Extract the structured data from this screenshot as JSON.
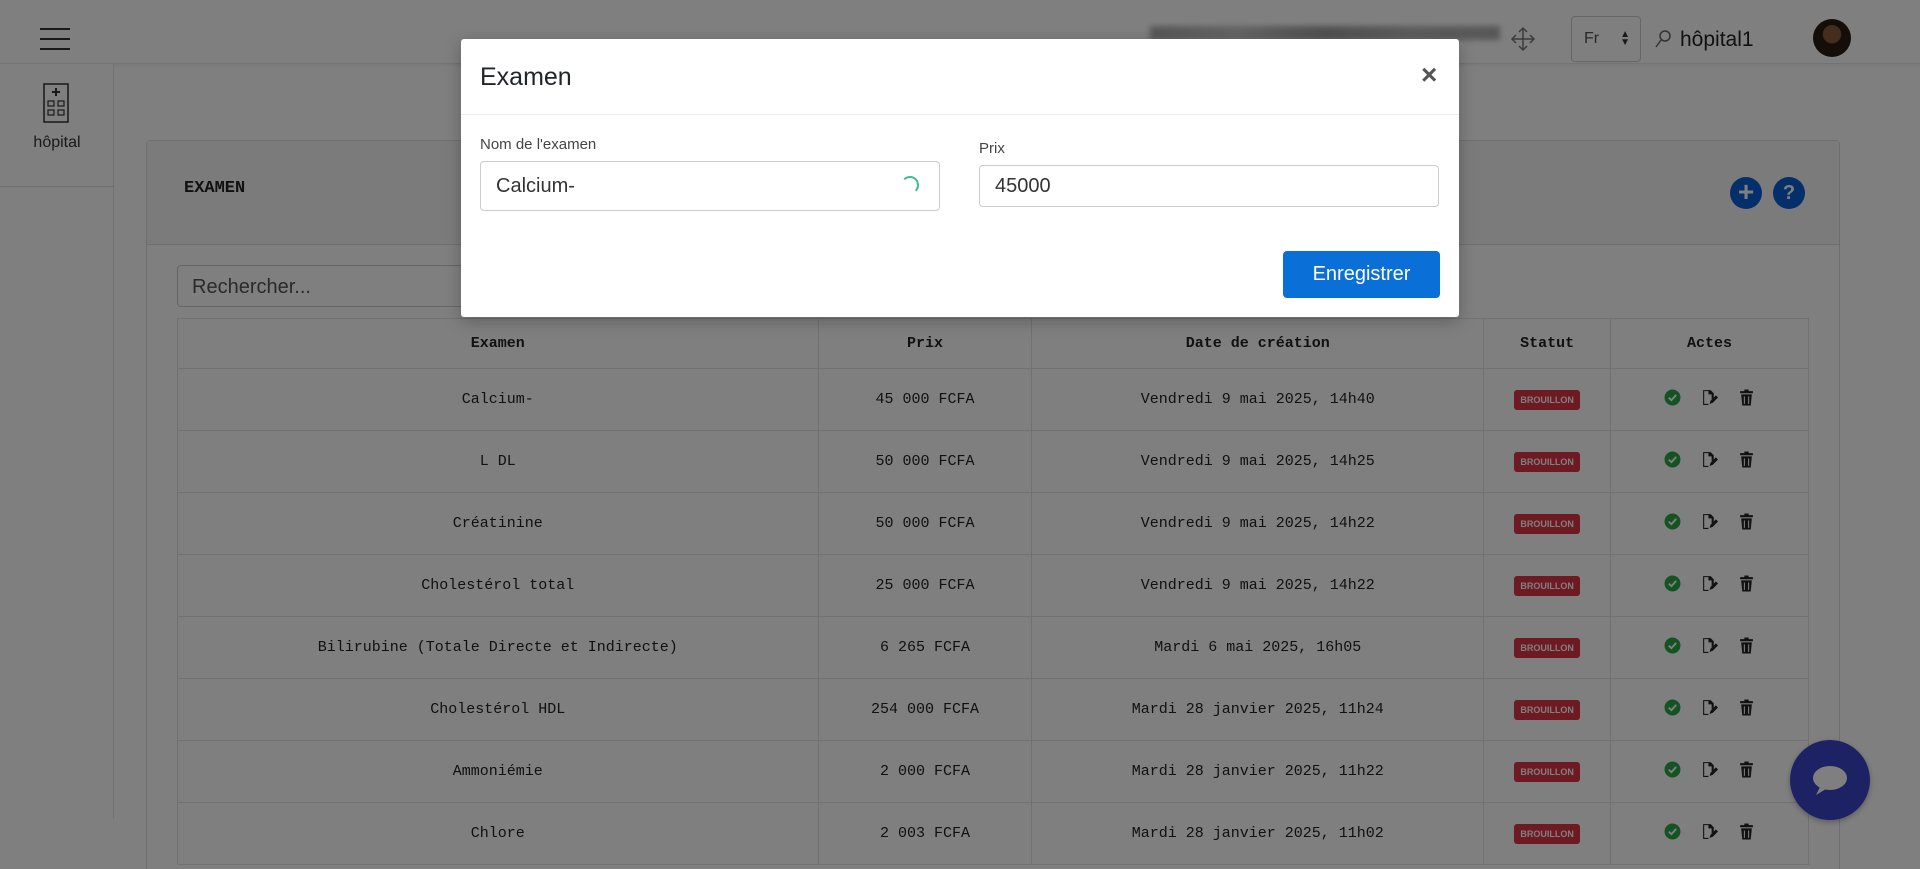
{
  "topbar": {
    "language": "Fr",
    "user_name": "hôpital1"
  },
  "sidebar": {
    "items": [
      {
        "label": "hôpital",
        "icon": "hospital-icon"
      }
    ]
  },
  "card": {
    "title": "EXAMEN",
    "search_placeholder": "Rechercher...",
    "help_label": "?"
  },
  "table": {
    "headers": [
      "Examen",
      "Prix",
      "Date de création",
      "Statut",
      "Actes"
    ],
    "rows": [
      {
        "examen": "Calcium-",
        "prix": "45 000 FCFA",
        "date": "Vendredi 9 mai 2025, 14h40",
        "statut": "BROUILLON"
      },
      {
        "examen": "L DL",
        "prix": "50 000 FCFA",
        "date": "Vendredi 9 mai 2025, 14h25",
        "statut": "BROUILLON"
      },
      {
        "examen": "Créatinine",
        "prix": "50 000 FCFA",
        "date": "Vendredi 9 mai 2025, 14h22",
        "statut": "BROUILLON"
      },
      {
        "examen": "Cholestérol total",
        "prix": "25 000 FCFA",
        "date": "Vendredi 9 mai 2025, 14h22",
        "statut": "BROUILLON"
      },
      {
        "examen": "Bilirubine (Totale Directe et Indirecte)",
        "prix": "6 265 FCFA",
        "date": "Mardi 6 mai 2025, 16h05",
        "statut": "BROUILLON"
      },
      {
        "examen": "Cholestérol HDL",
        "prix": "254 000 FCFA",
        "date": "Mardi 28 janvier 2025, 11h24",
        "statut": "BROUILLON"
      },
      {
        "examen": "Ammoniémie",
        "prix": "2 000 FCFA",
        "date": "Mardi 28 janvier 2025, 11h22",
        "statut": "BROUILLON"
      },
      {
        "examen": "Chlore",
        "prix": "2 003 FCFA",
        "date": "Mardi 28 janvier 2025, 11h02",
        "statut": "BROUILLON"
      }
    ],
    "status_color": "#dc3545"
  },
  "modal": {
    "title": "Examen",
    "close_label": "×",
    "name_label": "Nom de l'examen",
    "name_value": "Calcium-",
    "price_label": "Prix",
    "price_value": "45000",
    "save_label": "Enregistrer"
  },
  "colors": {
    "primary": "#0a6fd6",
    "danger": "#dc3545",
    "success": "#28a745",
    "chat": "#3b44c8"
  }
}
